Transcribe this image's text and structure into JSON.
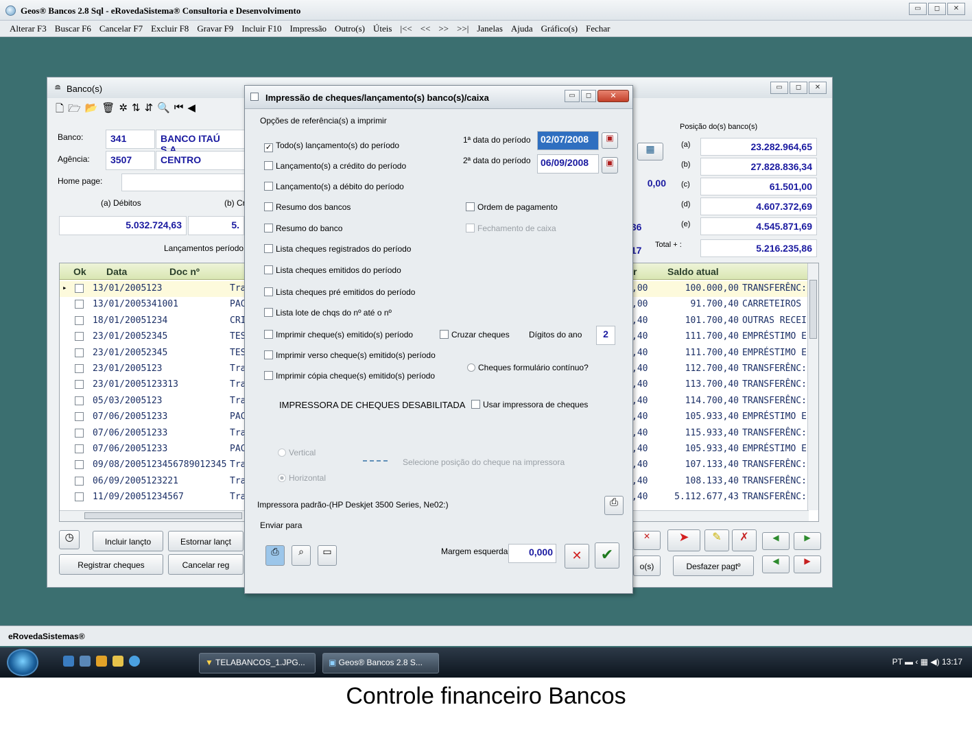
{
  "app": {
    "title": "Geos® Bancos 2.8 Sql - eRovedaSistema® Consultoria e Desenvolvimento",
    "menu": [
      "Alterar F3",
      "Buscar F6",
      "Cancelar F7",
      "Excluir F8",
      "Gravar F9",
      "Incluir F10",
      "Impressão",
      "Outro(s)",
      "Úteis",
      "|<<",
      "<<",
      ">>",
      ">>|",
      "Janelas",
      "Ajuda",
      "Gráfico(s)",
      "Fechar"
    ],
    "status": "eRovedaSistemas®"
  },
  "taskbar": {
    "item1": "TELABANCOS_1.JPG...",
    "item2": "Geos® Bancos 2.8 S...",
    "lang": "PT",
    "time": "13:17"
  },
  "banco": {
    "title": "Banco(s)",
    "labels": {
      "banco": "Banco:",
      "agencia": "Agência:",
      "homepage": "Home page:",
      "debitos": "(a) Débitos",
      "creditos": "(b) Cr",
      "lanc_periodo": "Lançamentos período",
      "posicao": "Posição do(s) banco(s)",
      "total": "Total + :"
    },
    "banco_num": "341",
    "banco_nome": "BANCO ITAÚ S.A.",
    "agencia_num": "3507",
    "agencia_nome": "CENTRO",
    "debitos_val": "5.032.724,63",
    "creditos_val": "5.",
    "mid_val": "0,00",
    "val36": ".36",
    "val17": ".17",
    "posicao": [
      {
        "k": "(a)",
        "v": "23.282.964,65"
      },
      {
        "k": "(b)",
        "v": "27.828.836,34"
      },
      {
        "k": "(c)",
        "v": "61.501,00"
      },
      {
        "k": "(d)",
        "v": "4.607.372,69"
      },
      {
        "k": "(e)",
        "v": "4.545.871,69"
      }
    ],
    "total_val": "5.216.235,86",
    "grid": {
      "headers": {
        "ok": "Ok",
        "data": "Data",
        "doc": "Doc nº",
        "r": "r",
        "saldo": "Saldo atual"
      },
      "rows": [
        {
          "data": "13/01/2005",
          "doc": "123",
          "h": "Tra",
          "r": ",00",
          "saldo": "100.000,00",
          "hist": "TRANSFERÊNC:"
        },
        {
          "data": "13/01/2005",
          "doc": "341001",
          "h": "PAC",
          "r": ",00",
          "saldo": "91.700,40",
          "hist": "CARRETEIROS"
        },
        {
          "data": "18/01/2005",
          "doc": "1234",
          "h": "CRI",
          "r": ",40",
          "saldo": "101.700,40",
          "hist": "OUTRAS RECEI"
        },
        {
          "data": "23/01/2005",
          "doc": "2345",
          "h": "TES",
          "r": ",40",
          "saldo": "111.700,40",
          "hist": "EMPRÉSTIMO E"
        },
        {
          "data": "23/01/2005",
          "doc": "2345",
          "h": "TES",
          "r": ",40",
          "saldo": "111.700,40",
          "hist": "EMPRÉSTIMO E"
        },
        {
          "data": "23/01/2005",
          "doc": "123",
          "h": "Tra",
          "r": ",40",
          "saldo": "112.700,40",
          "hist": "TRANSFERÊNC:"
        },
        {
          "data": "23/01/2005",
          "doc": "123313",
          "h": "Tra",
          "r": ",40",
          "saldo": "113.700,40",
          "hist": "TRANSFERÊNC:"
        },
        {
          "data": "05/03/2005",
          "doc": "123",
          "h": "Tra",
          "r": ",40",
          "saldo": "114.700,40",
          "hist": "TRANSFERÊNC:"
        },
        {
          "data": "07/06/2005",
          "doc": "1233",
          "h": "PAC",
          "r": ",40",
          "saldo": "105.933,40",
          "hist": "EMPRÉSTIMO E"
        },
        {
          "data": "07/06/2005",
          "doc": "1233",
          "h": "Tra",
          "r": ",40",
          "saldo": "115.933,40",
          "hist": "TRANSFERÊNC:"
        },
        {
          "data": "07/06/2005",
          "doc": "1233",
          "h": "PAC",
          "r": ",40",
          "saldo": "105.933,40",
          "hist": "EMPRÉSTIMO E"
        },
        {
          "data": "09/08/2005",
          "doc": "123456789012345",
          "h": "Tra",
          "r": ",40",
          "saldo": "107.133,40",
          "hist": "TRANSFERÊNC:"
        },
        {
          "data": "06/09/2005",
          "doc": "123221",
          "h": "Tra",
          "r": ",40",
          "saldo": "108.133,40",
          "hist": "TRANSFERÊNC:"
        },
        {
          "data": "11/09/2005",
          "doc": "1234567",
          "h": "Tra",
          "r": ",40",
          "saldo": "5.112.677,43",
          "hist": "TRANSFERÊNC:"
        }
      ]
    },
    "buttons": {
      "incluir": "Incluir lançto",
      "estornar": "Estornar lançt",
      "registrar": "Registrar cheques",
      "cancelar": "Cancelar reg",
      "os": "o(s)",
      "desfazer": "Desfazer pagtº"
    }
  },
  "dialog": {
    "title": "Impressão de cheques/lançamento(s) banco(s)/caixa",
    "group": "Opções de referência(s) a imprimir",
    "options": [
      {
        "label": "Todo(s) lançamento(s) do período",
        "checked": true
      },
      {
        "label": "Lançamento(s) a crédito do período",
        "checked": false
      },
      {
        "label": "Lançamento(s) a débito do período",
        "checked": false
      },
      {
        "label": "Resumo dos bancos",
        "checked": false
      },
      {
        "label": "Resumo do banco",
        "checked": false
      },
      {
        "label": "Lista cheques registrados do período",
        "checked": false
      },
      {
        "label": "Lista cheques emitidos do período",
        "checked": false
      },
      {
        "label": "Lista cheques pré emitidos do período",
        "checked": false
      },
      {
        "label": "Lista lote de chqs do nº  até o nº",
        "checked": false
      },
      {
        "label": "Imprimir cheque(s) emitido(s) período",
        "checked": false
      },
      {
        "label": "Imprimir verso cheque(s) emitido(s) período",
        "checked": false
      },
      {
        "label": "Imprimir cópia cheque(s) emitido(s) período",
        "checked": false
      }
    ],
    "data1_label": "1ª data do período",
    "data1": "02/07/2008",
    "data2_label": "2ª data do período",
    "data2": "06/09/2008",
    "ordem": "Ordem de pagamento",
    "fechamento": "Fechamento de caixa",
    "cruzar": "Cruzar cheques",
    "digitos_label": "Dígitos do ano",
    "digitos": "2",
    "formulario": "Cheques formulário contínuo?",
    "impressora_status": "IMPRESSORA DE CHEQUES DESABILITADA",
    "usar_impressora": "Usar impressora de cheques",
    "vertical": "Vertical",
    "horizontal": "Horizontal",
    "selecione": "Selecione posição do cheque na impressora",
    "impressora_padrao": "Impressora padrão-(HP Deskjet 3500 Series, Ne02:)",
    "enviar_para": "Enviar para",
    "margem_label": "Margem esquerda",
    "margem": "0,000"
  },
  "caption": "Controle financeiro Bancos"
}
